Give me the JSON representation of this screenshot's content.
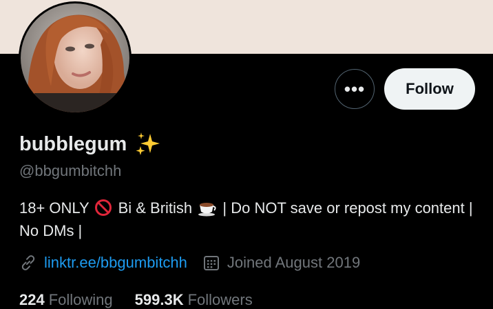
{
  "profile": {
    "display_name": "bubblegum",
    "handle": "@bbgumbitchh",
    "bio": {
      "part1": "18+ ONLY",
      "part2": "Bi & British",
      "part3": "| Do NOT save or repost my content | No DMs |"
    },
    "link": "linktr.ee/bbgumbitchh",
    "joined": "Joined August 2019"
  },
  "actions": {
    "more_label": "•••",
    "follow_label": "Follow"
  },
  "stats": {
    "following_count": "224",
    "following_label": "Following",
    "followers_count": "599.3K",
    "followers_label": "Followers"
  },
  "icons": {
    "name_badge": "sparkles-icon",
    "bio_emoji_1": "no-entry-icon",
    "bio_emoji_2": "teacup-icon",
    "link": "link-icon",
    "joined": "calendar-icon"
  },
  "colors": {
    "background": "#000000",
    "banner": "#efe4dc",
    "text_primary": "#e7e9ea",
    "text_secondary": "#71767b",
    "link": "#1d9bf0",
    "follow_bg": "#eff3f4",
    "follow_text": "#0f1419"
  }
}
